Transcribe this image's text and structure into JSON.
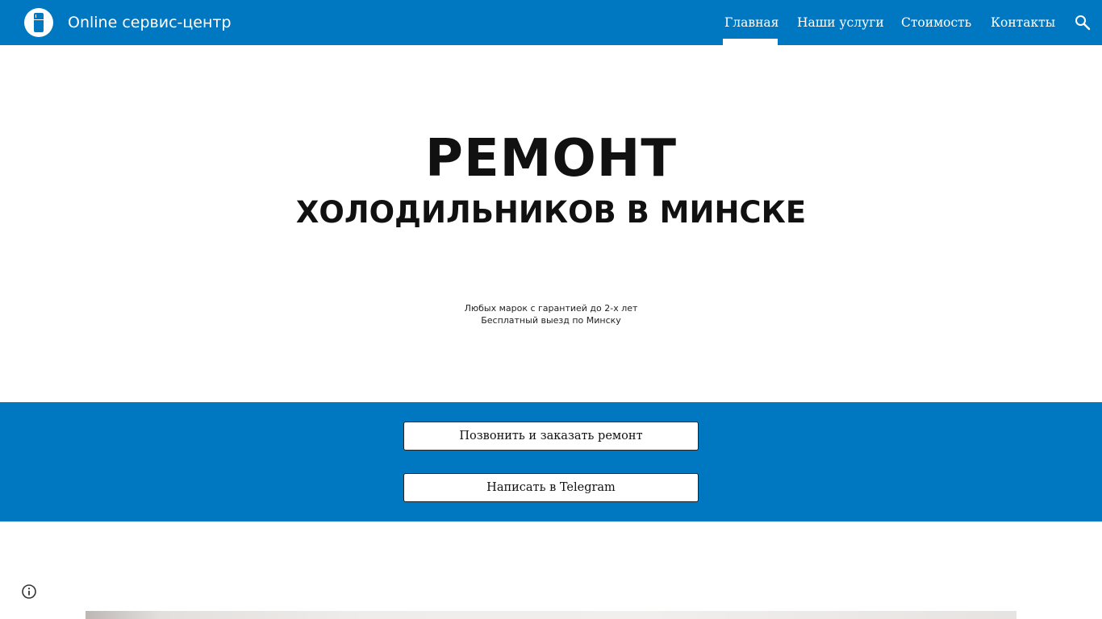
{
  "header": {
    "site_title": "Online сервис-центр",
    "logo_icon": "fridge-icon",
    "nav": [
      {
        "label": "Главная",
        "active": true
      },
      {
        "label": "Наши услуги",
        "active": false
      },
      {
        "label": "Стоимость",
        "active": false
      },
      {
        "label": "Контакты",
        "active": false
      }
    ],
    "search_icon": "search-icon"
  },
  "hero": {
    "title": "РЕМОНТ",
    "subtitle": "ХОЛОДИЛЬНИКОВ В МИНСКЕ",
    "line1": "Любых марок с гарантией до 2-х лет",
    "line2": "Бесплатный выезд по Минску"
  },
  "cta": {
    "call_label": "Позвонить и заказать ремонт",
    "telegram_label": "Написать в Telegram"
  },
  "footer": {
    "info_icon": "info-icon"
  },
  "colors": {
    "brand": "#0078c1",
    "text": "#111111",
    "background": "#ffffff"
  }
}
